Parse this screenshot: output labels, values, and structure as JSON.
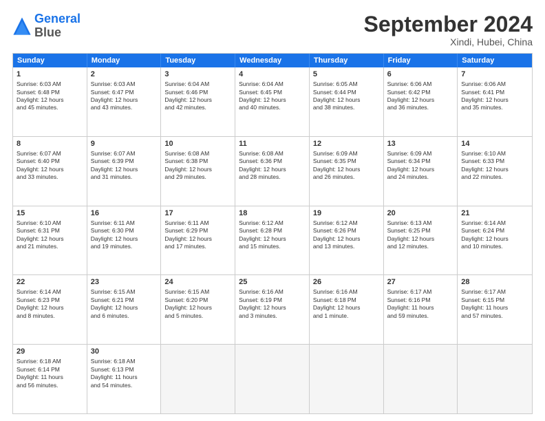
{
  "logo": {
    "line1": "General",
    "line2": "Blue"
  },
  "title": "September 2024",
  "subtitle": "Xindi, Hubei, China",
  "headers": [
    "Sunday",
    "Monday",
    "Tuesday",
    "Wednesday",
    "Thursday",
    "Friday",
    "Saturday"
  ],
  "weeks": [
    [
      {
        "day": "1",
        "lines": [
          "Sunrise: 6:03 AM",
          "Sunset: 6:48 PM",
          "Daylight: 12 hours",
          "and 45 minutes."
        ]
      },
      {
        "day": "2",
        "lines": [
          "Sunrise: 6:03 AM",
          "Sunset: 6:47 PM",
          "Daylight: 12 hours",
          "and 43 minutes."
        ]
      },
      {
        "day": "3",
        "lines": [
          "Sunrise: 6:04 AM",
          "Sunset: 6:46 PM",
          "Daylight: 12 hours",
          "and 42 minutes."
        ]
      },
      {
        "day": "4",
        "lines": [
          "Sunrise: 6:04 AM",
          "Sunset: 6:45 PM",
          "Daylight: 12 hours",
          "and 40 minutes."
        ]
      },
      {
        "day": "5",
        "lines": [
          "Sunrise: 6:05 AM",
          "Sunset: 6:44 PM",
          "Daylight: 12 hours",
          "and 38 minutes."
        ]
      },
      {
        "day": "6",
        "lines": [
          "Sunrise: 6:06 AM",
          "Sunset: 6:42 PM",
          "Daylight: 12 hours",
          "and 36 minutes."
        ]
      },
      {
        "day": "7",
        "lines": [
          "Sunrise: 6:06 AM",
          "Sunset: 6:41 PM",
          "Daylight: 12 hours",
          "and 35 minutes."
        ]
      }
    ],
    [
      {
        "day": "8",
        "lines": [
          "Sunrise: 6:07 AM",
          "Sunset: 6:40 PM",
          "Daylight: 12 hours",
          "and 33 minutes."
        ]
      },
      {
        "day": "9",
        "lines": [
          "Sunrise: 6:07 AM",
          "Sunset: 6:39 PM",
          "Daylight: 12 hours",
          "and 31 minutes."
        ]
      },
      {
        "day": "10",
        "lines": [
          "Sunrise: 6:08 AM",
          "Sunset: 6:38 PM",
          "Daylight: 12 hours",
          "and 29 minutes."
        ]
      },
      {
        "day": "11",
        "lines": [
          "Sunrise: 6:08 AM",
          "Sunset: 6:36 PM",
          "Daylight: 12 hours",
          "and 28 minutes."
        ]
      },
      {
        "day": "12",
        "lines": [
          "Sunrise: 6:09 AM",
          "Sunset: 6:35 PM",
          "Daylight: 12 hours",
          "and 26 minutes."
        ]
      },
      {
        "day": "13",
        "lines": [
          "Sunrise: 6:09 AM",
          "Sunset: 6:34 PM",
          "Daylight: 12 hours",
          "and 24 minutes."
        ]
      },
      {
        "day": "14",
        "lines": [
          "Sunrise: 6:10 AM",
          "Sunset: 6:33 PM",
          "Daylight: 12 hours",
          "and 22 minutes."
        ]
      }
    ],
    [
      {
        "day": "15",
        "lines": [
          "Sunrise: 6:10 AM",
          "Sunset: 6:31 PM",
          "Daylight: 12 hours",
          "and 21 minutes."
        ]
      },
      {
        "day": "16",
        "lines": [
          "Sunrise: 6:11 AM",
          "Sunset: 6:30 PM",
          "Daylight: 12 hours",
          "and 19 minutes."
        ]
      },
      {
        "day": "17",
        "lines": [
          "Sunrise: 6:11 AM",
          "Sunset: 6:29 PM",
          "Daylight: 12 hours",
          "and 17 minutes."
        ]
      },
      {
        "day": "18",
        "lines": [
          "Sunrise: 6:12 AM",
          "Sunset: 6:28 PM",
          "Daylight: 12 hours",
          "and 15 minutes."
        ]
      },
      {
        "day": "19",
        "lines": [
          "Sunrise: 6:12 AM",
          "Sunset: 6:26 PM",
          "Daylight: 12 hours",
          "and 13 minutes."
        ]
      },
      {
        "day": "20",
        "lines": [
          "Sunrise: 6:13 AM",
          "Sunset: 6:25 PM",
          "Daylight: 12 hours",
          "and 12 minutes."
        ]
      },
      {
        "day": "21",
        "lines": [
          "Sunrise: 6:14 AM",
          "Sunset: 6:24 PM",
          "Daylight: 12 hours",
          "and 10 minutes."
        ]
      }
    ],
    [
      {
        "day": "22",
        "lines": [
          "Sunrise: 6:14 AM",
          "Sunset: 6:23 PM",
          "Daylight: 12 hours",
          "and 8 minutes."
        ]
      },
      {
        "day": "23",
        "lines": [
          "Sunrise: 6:15 AM",
          "Sunset: 6:21 PM",
          "Daylight: 12 hours",
          "and 6 minutes."
        ]
      },
      {
        "day": "24",
        "lines": [
          "Sunrise: 6:15 AM",
          "Sunset: 6:20 PM",
          "Daylight: 12 hours",
          "and 5 minutes."
        ]
      },
      {
        "day": "25",
        "lines": [
          "Sunrise: 6:16 AM",
          "Sunset: 6:19 PM",
          "Daylight: 12 hours",
          "and 3 minutes."
        ]
      },
      {
        "day": "26",
        "lines": [
          "Sunrise: 6:16 AM",
          "Sunset: 6:18 PM",
          "Daylight: 12 hours",
          "and 1 minute."
        ]
      },
      {
        "day": "27",
        "lines": [
          "Sunrise: 6:17 AM",
          "Sunset: 6:16 PM",
          "Daylight: 11 hours",
          "and 59 minutes."
        ]
      },
      {
        "day": "28",
        "lines": [
          "Sunrise: 6:17 AM",
          "Sunset: 6:15 PM",
          "Daylight: 11 hours",
          "and 57 minutes."
        ]
      }
    ],
    [
      {
        "day": "29",
        "lines": [
          "Sunrise: 6:18 AM",
          "Sunset: 6:14 PM",
          "Daylight: 11 hours",
          "and 56 minutes."
        ]
      },
      {
        "day": "30",
        "lines": [
          "Sunrise: 6:18 AM",
          "Sunset: 6:13 PM",
          "Daylight: 11 hours",
          "and 54 minutes."
        ]
      },
      {
        "day": "",
        "lines": []
      },
      {
        "day": "",
        "lines": []
      },
      {
        "day": "",
        "lines": []
      },
      {
        "day": "",
        "lines": []
      },
      {
        "day": "",
        "lines": []
      }
    ]
  ]
}
